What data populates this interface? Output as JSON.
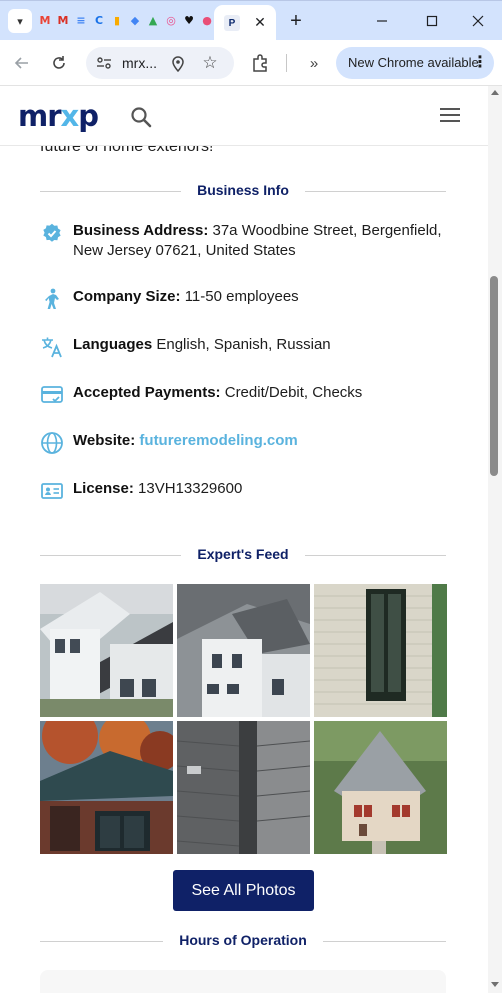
{
  "browser": {
    "favicons": [
      {
        "name": "gmail-icon",
        "glyph": "M",
        "color": "#ea4335"
      },
      {
        "name": "gmail-icon",
        "glyph": "M",
        "color": "#d93025"
      },
      {
        "name": "docs-icon",
        "glyph": "≡",
        "color": "#4285f4"
      },
      {
        "name": "c-icon",
        "glyph": "C",
        "color": "#1a73e8"
      },
      {
        "name": "analytics-icon",
        "glyph": "▮",
        "color": "#f9ab00"
      },
      {
        "name": "diamond-icon",
        "glyph": "◆",
        "color": "#4285f4"
      },
      {
        "name": "ads-icon",
        "glyph": "▲",
        "color": "#34a853"
      },
      {
        "name": "dribbble-icon",
        "glyph": "◎",
        "color": "#ea4c89"
      },
      {
        "name": "heart-icon",
        "glyph": "♥",
        "color": "#111111"
      },
      {
        "name": "shape-icon",
        "glyph": "●",
        "color": "#e94e77"
      }
    ],
    "active_tab_favicon": "P",
    "url": "mrx...",
    "update_label": "New Chrome available"
  },
  "site": {
    "logo": {
      "main": "mr",
      "accent": "x",
      "tail": "p"
    },
    "cut_text": "future of home exteriors!"
  },
  "business_info": {
    "heading": "Business Info",
    "rows": [
      {
        "icon": "verified-badge-icon",
        "label": "Business Address:",
        "value": "37a Woodbine Street, Bergenfield, New Jersey 07621, United States"
      },
      {
        "icon": "worker-icon",
        "label": "Company Size:",
        "value": "11-50 employees"
      },
      {
        "icon": "translate-icon",
        "label": "Languages",
        "value": "English, Spanish, Russian"
      },
      {
        "icon": "credit-card-icon",
        "label": "Accepted Payments:",
        "value": "Credit/Debit, Checks"
      },
      {
        "icon": "globe-icon",
        "label": "Website:",
        "value": "futureremodeling.com"
      },
      {
        "icon": "id-card-icon",
        "label": "License:",
        "value": "13VH13329600"
      }
    ]
  },
  "experts_feed": {
    "heading": "Expert's Feed",
    "see_all_label": "See All Photos"
  },
  "hours": {
    "heading": "Hours of Operation"
  },
  "colors": {
    "brand_navy": "#0f2167",
    "accent_blue": "#5ab3de",
    "chrome_tab_strip": "#d3e3fd"
  }
}
